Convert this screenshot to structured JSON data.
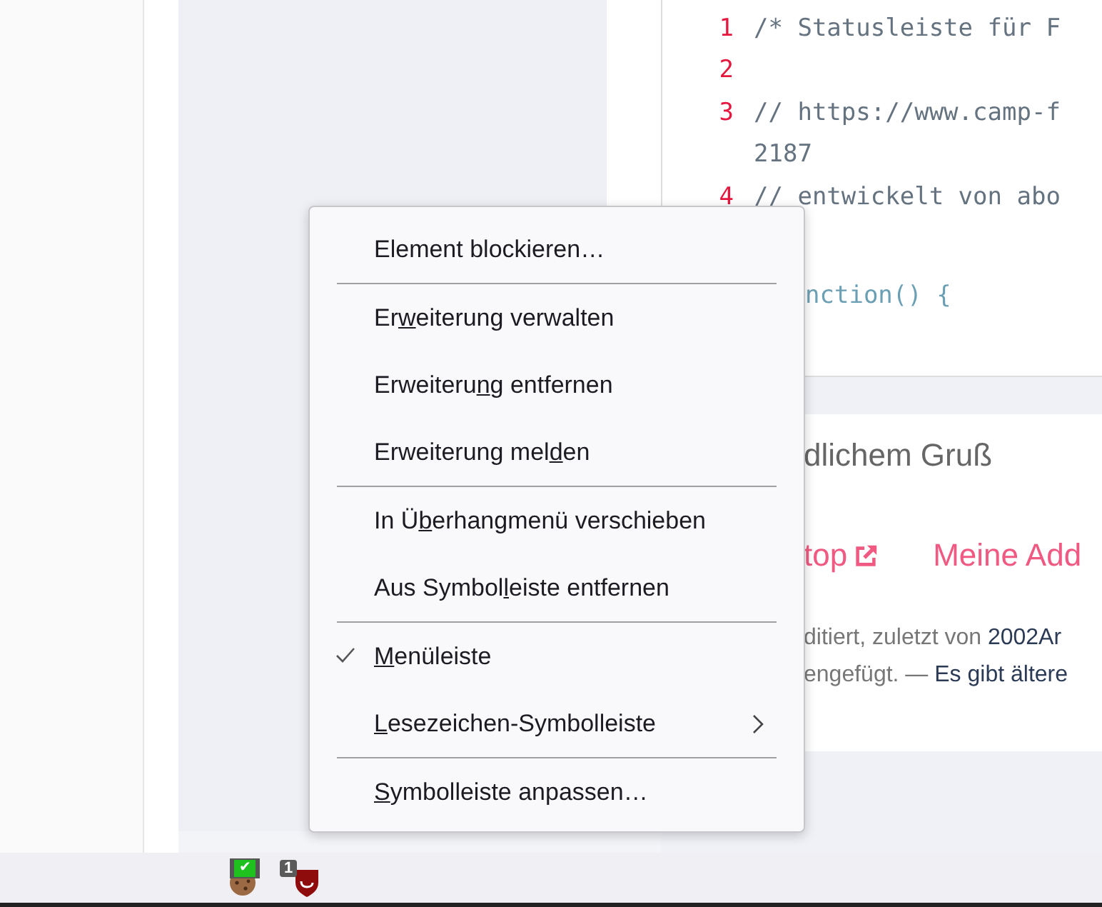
{
  "code": {
    "lines": [
      {
        "number": "1",
        "text": "/* Statusleiste für F"
      },
      {
        "number": "2"
      },
      {
        "number": "3",
        "text": "// https://www.camp-f"
      },
      {
        "text": "2187"
      },
      {
        "number": "4",
        "text": "// entwickelt von abo"
      }
    ],
    "faded_line": "nction() {"
  },
  "post": {
    "greeting": "dlichem Gruß",
    "links": [
      {
        "label": "top",
        "external": true
      },
      {
        "label": "Meine Add",
        "external": false
      }
    ],
    "meta_lines": [
      [
        {
          "text": "ditiert, zuletzt von ",
          "link": false
        },
        {
          "text": "2002Ar",
          "link": true
        }
      ],
      [
        {
          "text": "engefügt. — ",
          "link": false
        },
        {
          "text": "Es gibt ältere",
          "link": true
        }
      ]
    ]
  },
  "context_menu": {
    "groups": [
      [
        {
          "label": {
            "pre": "Element blockieren…"
          },
          "checked": false,
          "submenu": false
        }
      ],
      [
        {
          "label": {
            "pre": "Er",
            "key": "w",
            "post": "eiterung verwalten"
          },
          "checked": false,
          "submenu": false
        },
        {
          "label": {
            "pre": "Erweiteru",
            "key": "n",
            "post": "g entfernen"
          },
          "checked": false,
          "submenu": false
        },
        {
          "label": {
            "pre": "Erweiterung mel",
            "key": "d",
            "post": "en"
          },
          "checked": false,
          "submenu": false
        }
      ],
      [
        {
          "label": {
            "pre": "In Ü",
            "key": "b",
            "post": "erhangmenü verschieben"
          },
          "checked": false,
          "submenu": false
        },
        {
          "label": {
            "pre": "Aus Symbol",
            "key": "l",
            "post": "eiste entfernen"
          },
          "checked": false,
          "submenu": false
        }
      ],
      [
        {
          "label": {
            "key": "M",
            "post": "enüleiste"
          },
          "checked": true,
          "submenu": false
        },
        {
          "label": {
            "key": "L",
            "post": "esezeichen-Symbolleiste"
          },
          "checked": false,
          "submenu": true
        }
      ],
      [
        {
          "label": {
            "key": "S",
            "post": "ymbolleiste anpassen…"
          },
          "checked": false,
          "submenu": false
        }
      ]
    ]
  },
  "status_bar": {
    "extensions": [
      {
        "kind": "cookie",
        "badge": "✔"
      },
      {
        "kind": "shield",
        "badge": "1"
      }
    ]
  }
}
